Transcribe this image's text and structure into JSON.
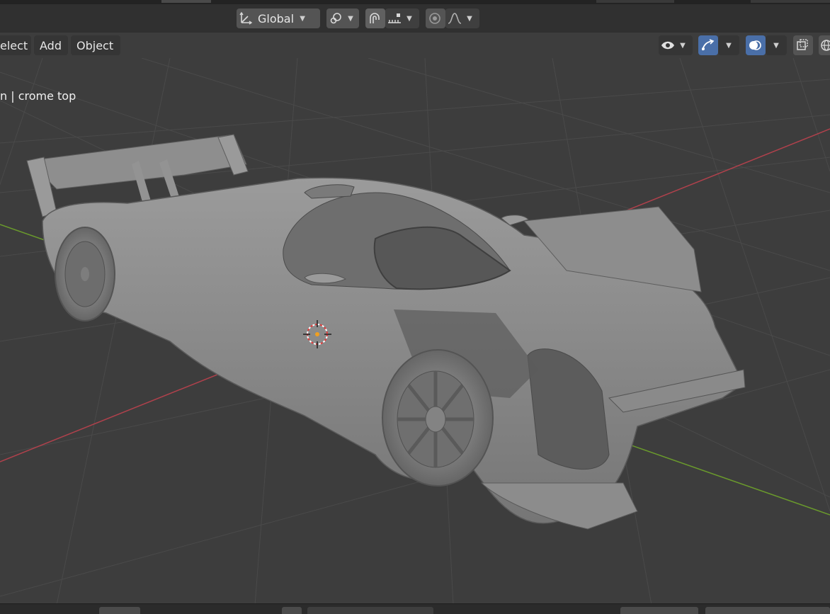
{
  "header": {
    "transform_orientation": "Global",
    "icons": [
      "transform-axes-icon",
      "pivot-icon",
      "snap-icon",
      "snap-increment-icon",
      "proportional-edit-icon",
      "falloff-curve-icon"
    ]
  },
  "viewport_menu": {
    "select_label": "elect",
    "add_label": "Add",
    "object_label": "Object"
  },
  "viewport_header_right": {
    "icons": [
      "visibility-eye-icon",
      "gizmo-icon",
      "overlay-icon",
      "xray-icon",
      "wireframe-shading-icon"
    ]
  },
  "viewport_overlay": {
    "object_info": "n | crome top"
  },
  "colors": {
    "x_axis": "#b0414c",
    "y_axis": "#6a9a2c",
    "grid": "#4a4a4a",
    "background": "#3d3d3d",
    "active_button": "#4a6fa8"
  }
}
